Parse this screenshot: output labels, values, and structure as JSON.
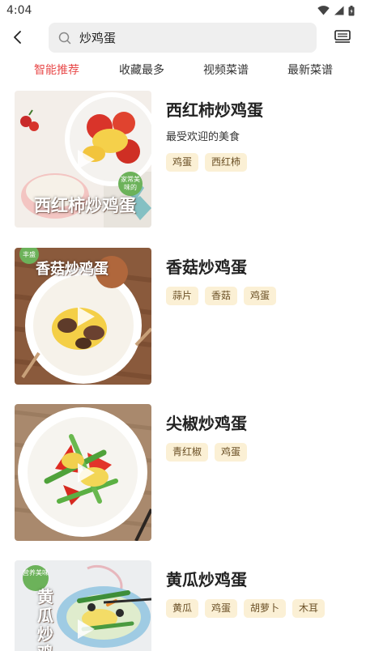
{
  "status": {
    "time": "4:04"
  },
  "search": {
    "query": "炒鸡蛋"
  },
  "tabs": [
    {
      "label": "智能推荐",
      "active": true
    },
    {
      "label": "收藏最多",
      "active": false
    },
    {
      "label": "视频菜谱",
      "active": false
    },
    {
      "label": "最新菜谱",
      "active": false
    }
  ],
  "accent_color": "#e84a4a",
  "tag_bg_color": "#fbf0d5",
  "recipes": [
    {
      "title": "西红柿炒鸡蛋",
      "subtitle": "最受欢迎的美食",
      "tags": [
        "鸡蛋",
        "西红柿"
      ],
      "image_text": "西红柿炒鸡蛋",
      "badge": "家常美味的"
    },
    {
      "title": "香菇炒鸡蛋",
      "subtitle": "",
      "tags": [
        "蒜片",
        "香菇",
        "鸡蛋"
      ],
      "image_text": "香菇炒鸡蛋",
      "badge": "丰盛"
    },
    {
      "title": "尖椒炒鸡蛋",
      "subtitle": "",
      "tags": [
        "青红椒",
        "鸡蛋"
      ],
      "image_text": "",
      "badge": ""
    },
    {
      "title": "黄瓜炒鸡蛋",
      "subtitle": "",
      "tags": [
        "黄瓜",
        "鸡蛋",
        "胡萝卜",
        "木耳"
      ],
      "image_text": "黄瓜炒鸡",
      "badge": "营养美味"
    }
  ]
}
